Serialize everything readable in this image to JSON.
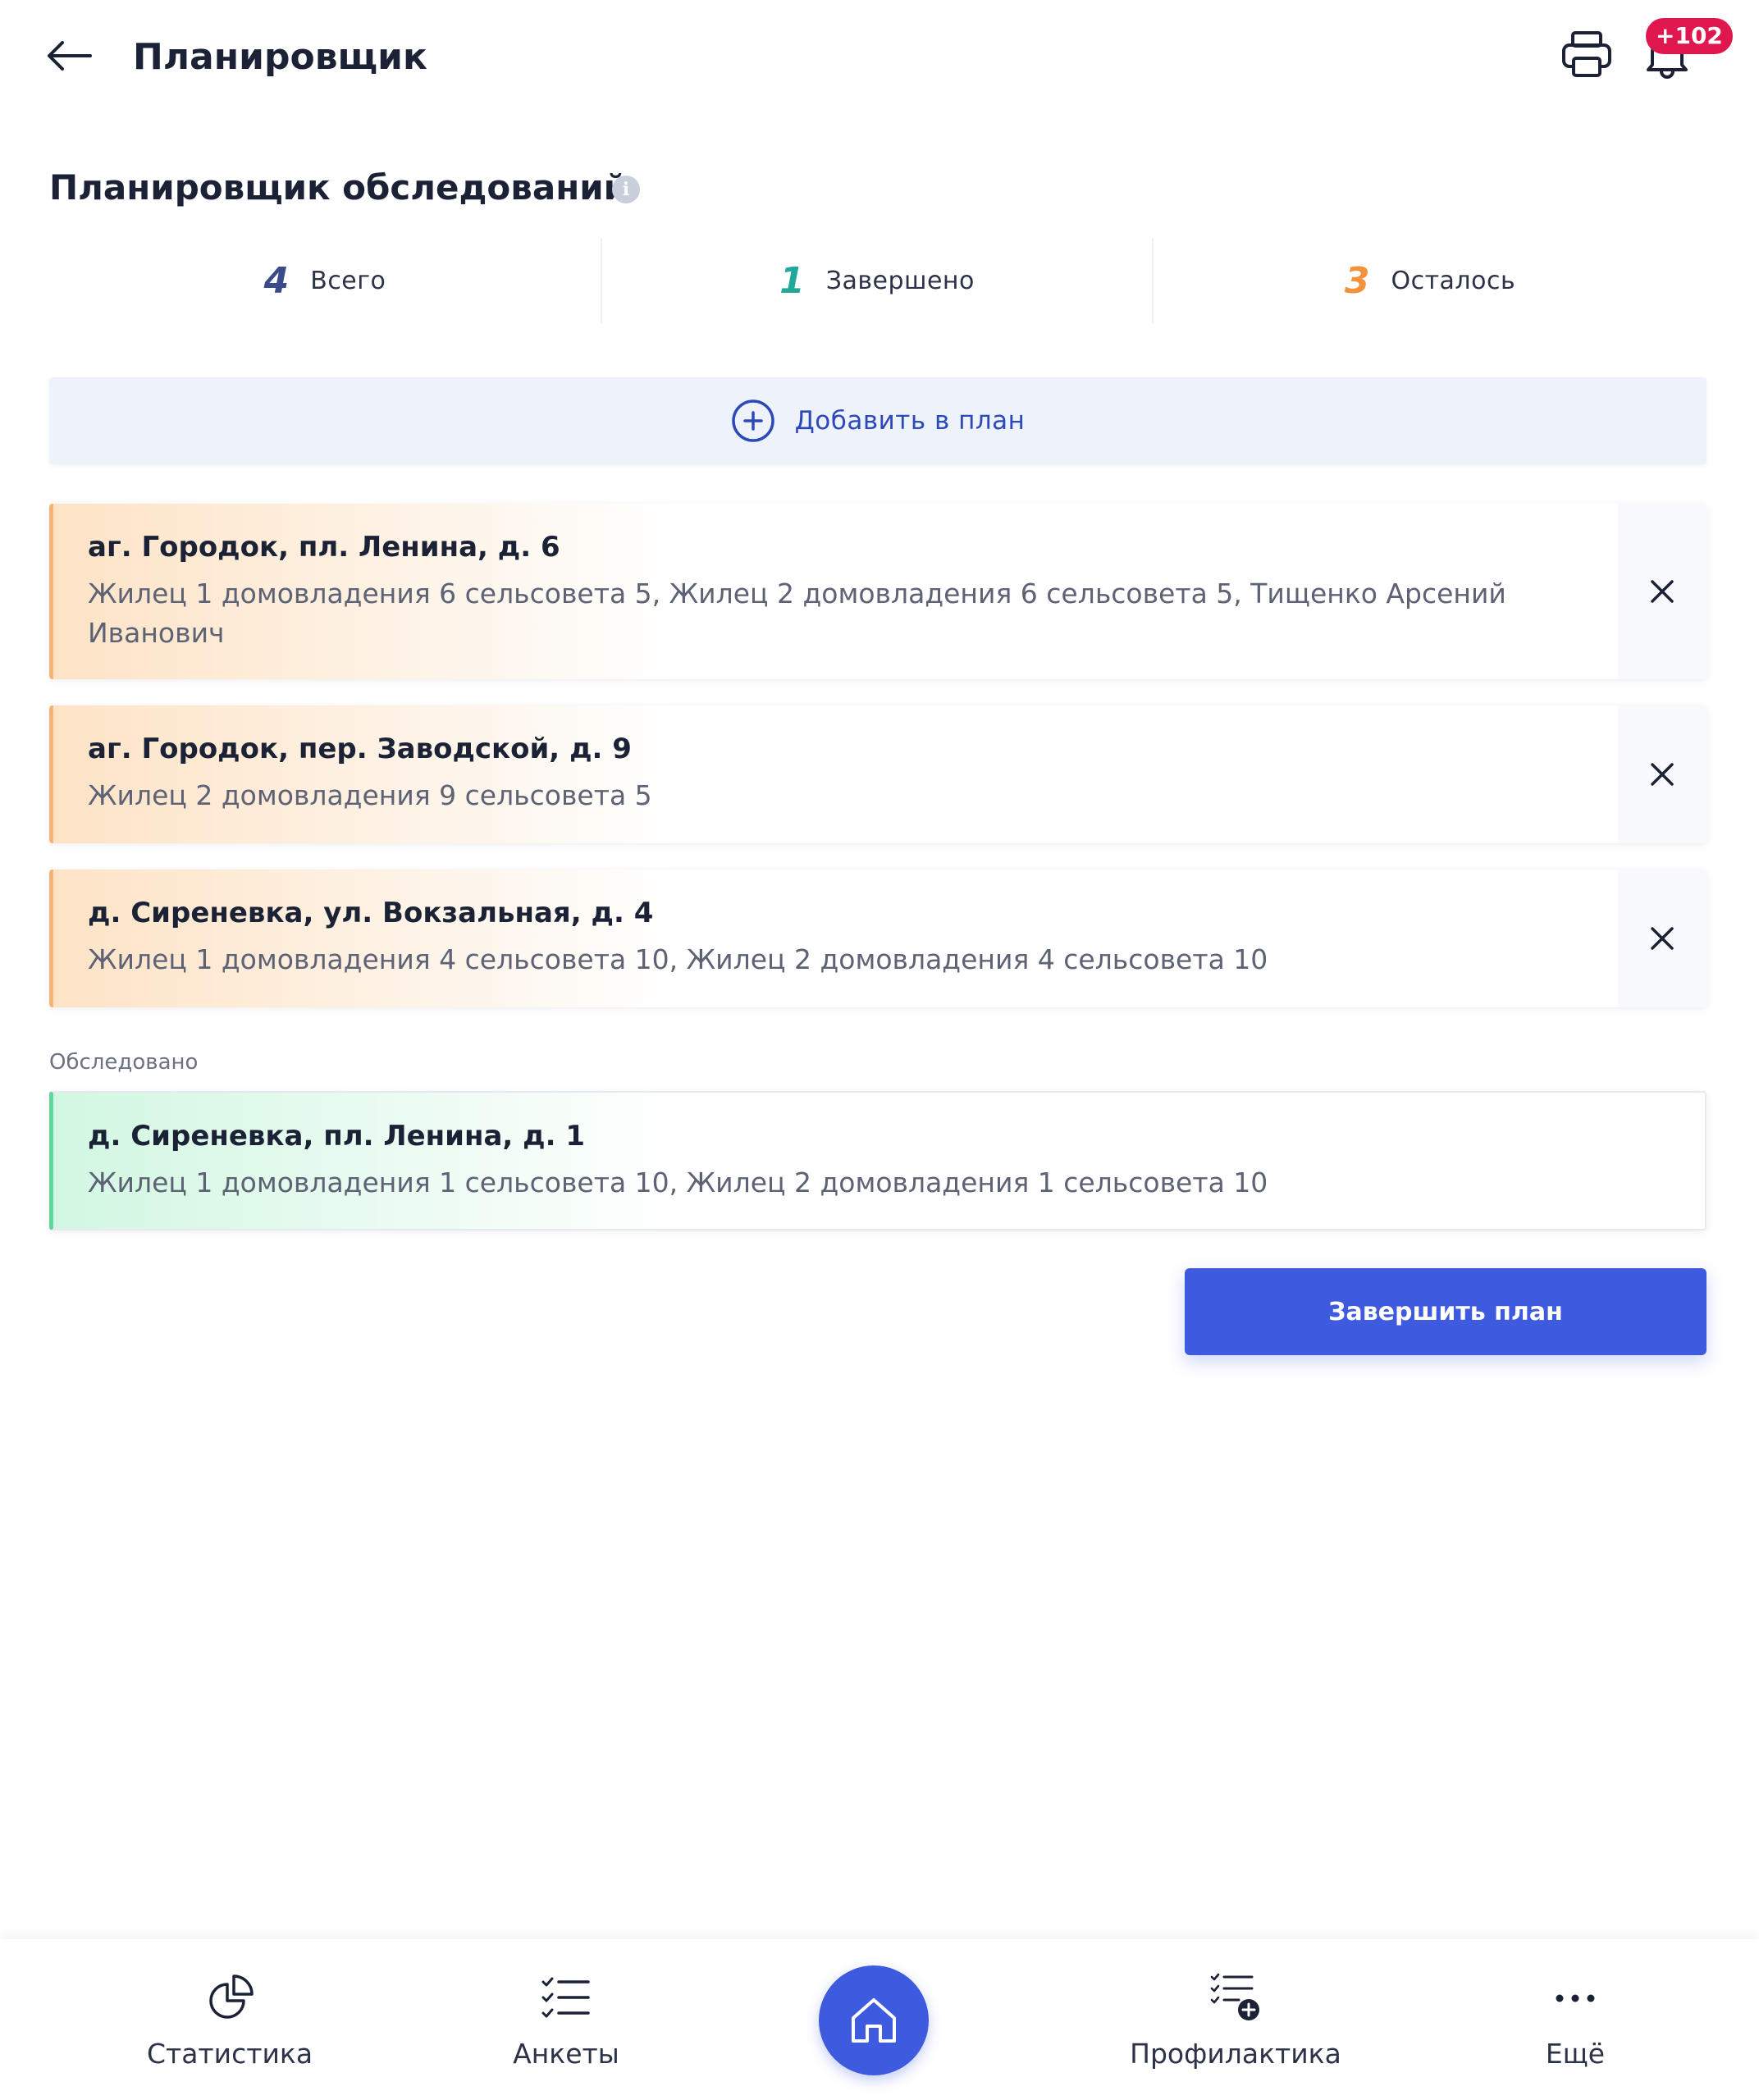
{
  "header": {
    "title": "Планировщик",
    "notifications_badge": "+102"
  },
  "planner": {
    "title": "Планировщик обследований",
    "info_icon": "i"
  },
  "stats": [
    {
      "value": "4",
      "label": "Всего",
      "color": "#3b4a8a"
    },
    {
      "value": "1",
      "label": "Завершено",
      "color": "#22a89a"
    },
    {
      "value": "3",
      "label": "Осталось",
      "color": "#f2923a"
    }
  ],
  "add_plan": {
    "label": "Добавить в план"
  },
  "plan_items": [
    {
      "title": "аг. Городок, пл. Ленина, д. 6",
      "residents": "Жилец 1 домовладения 6 сельсовета 5, Жилец 2 домовладения 6 сельсовета 5, Тищенко Арсений Иванович"
    },
    {
      "title": "аг. Городок, пер. Заводской, д. 9",
      "residents": "Жилец 2 домовладения 9 сельсовета 5"
    },
    {
      "title": "д. Сиреневка, ул. Вокзальная, д. 4",
      "residents": "Жилец 1 домовладения 4 сельсовета 10, Жилец 2 домовладения 4 сельсовета 10"
    }
  ],
  "inspected": {
    "label": "Обследовано",
    "items": [
      {
        "title": "д. Сиреневка, пл. Ленина, д. 1",
        "residents": "Жилец 1 домовладения 1 сельсовета 10, Жилец 2 домовладения 1 сельсовета 10"
      }
    ]
  },
  "finish_button": {
    "label": "Завершить план"
  },
  "bottom_nav": {
    "statistics": "Статистика",
    "surveys": "Анкеты",
    "prevention": "Профилактика",
    "more": "Ещё"
  },
  "icons": {
    "back": "arrow-left-icon",
    "print": "printer-icon",
    "notifications": "bell-icon",
    "add": "plus-circle-icon",
    "remove": "close-icon",
    "statistics": "pie-chart-icon",
    "surveys": "checklist-icon",
    "home": "home-icon",
    "prevention": "checklist-add-icon",
    "more": "more-dots-icon"
  }
}
